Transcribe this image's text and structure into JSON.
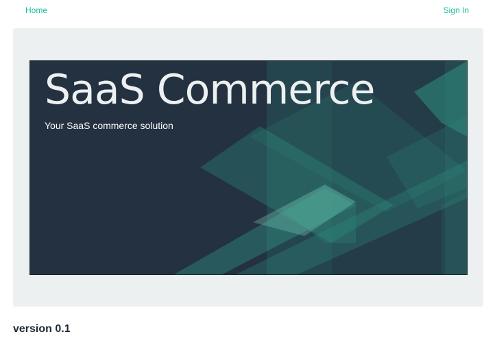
{
  "nav": {
    "home_label": "Home",
    "signin_label": "Sign In"
  },
  "hero": {
    "title": "SaaS Commerce",
    "subtitle": "Your SaaS commerce solution"
  },
  "footer": {
    "version": "version 0.1"
  },
  "colors": {
    "accent": "#18bc9c",
    "hero_background": "#233140",
    "jumbotron_background": "#ecf0f1"
  }
}
